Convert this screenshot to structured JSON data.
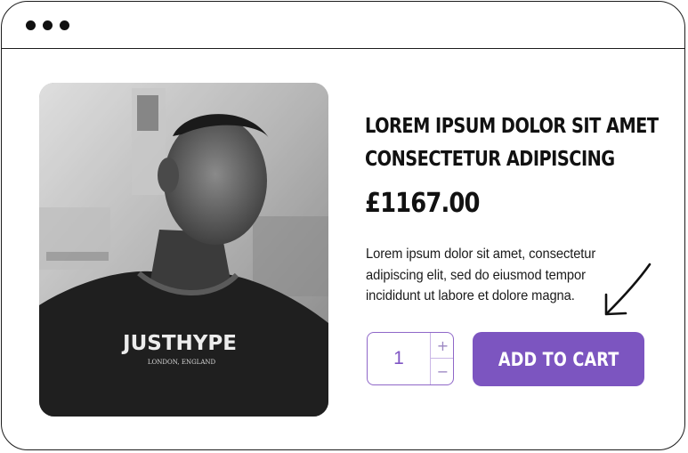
{
  "window": {
    "controls": [
      "dot",
      "dot",
      "dot"
    ]
  },
  "product": {
    "title_line1": "LOREM IPSUM DOLOR SIT AMET",
    "title_line2": "CONSECTETUR ADIPISCING",
    "price": "£1167.00",
    "description_line1": "Lorem ipsum dolor sit amet, consectetur",
    "description_line2": "adipiscing elit, sed do eiusmod tempor",
    "description_line3": "incididunt ut labore et dolore magna.",
    "image": {
      "shirt_brand": "JUSTHYPE",
      "shirt_location": "LONDON, ENGLAND"
    }
  },
  "quantity": {
    "value": "1",
    "increment_symbol": "+",
    "decrement_symbol": "−"
  },
  "actions": {
    "add_to_cart_label": "ADD TO CART"
  },
  "colors": {
    "accent": "#7c55c0",
    "stepper_border": "#8f67c8",
    "text": "#111111"
  },
  "icons": {
    "annotation": "hand-drawn-arrow-icon"
  }
}
